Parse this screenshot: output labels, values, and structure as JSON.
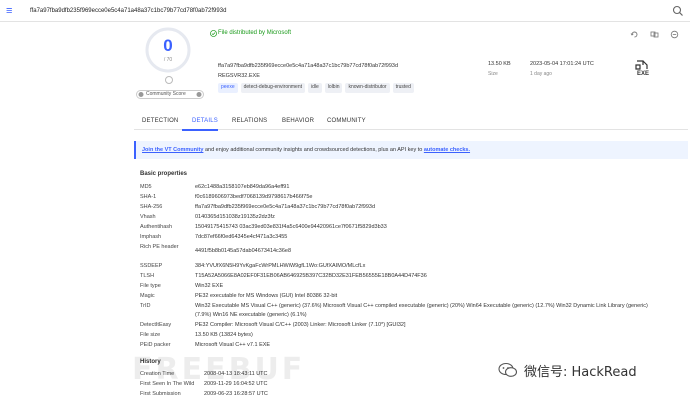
{
  "search": {
    "value": "ffa7a97fba9dfb235f969ecce0e5c4a71a48a37c1bc79b77cd78f0ab72f993d"
  },
  "score": {
    "detections": "0",
    "total": "/ 70",
    "community_label": "Community Score"
  },
  "summary": {
    "status": "File distributed by Microsoft",
    "hash": "ffa7a97fba9dfb235f969ecce0e5c4a71a48a37c1bc79b77cd78f0ab72f993d",
    "filename": "REGSVR32.EXE",
    "tags": [
      "peexe",
      "detect-debug-environment",
      "idle",
      "lolbin",
      "known-distributor",
      "trusted"
    ],
    "size_value": "13.50 KB",
    "size_label": "Size",
    "date_value": "2023-05-04 17:01:24 UTC",
    "date_label": "1 day ago",
    "filetype": "EXE"
  },
  "tabs": [
    "DETECTION",
    "DETAILS",
    "RELATIONS",
    "BEHAVIOR",
    "COMMUNITY"
  ],
  "banner": {
    "link1": "Join the VT Community",
    "text": " and enjoy additional community insights and crowdsourced detections, plus an API key to ",
    "link2": "automate checks."
  },
  "basic": {
    "title": "Basic properties",
    "rows": [
      {
        "k": "MD5",
        "v": "e62c1488a3158107eb849da96a4eff91"
      },
      {
        "k": "SHA-1",
        "v": "f0c6189606973bedf7068139d9798617b466f75e"
      },
      {
        "k": "SHA-256",
        "v": "ffa7a97fba9dfb235f969ecce0e5c4a71a48a37c1bc79b77cd78f0ab72f993d"
      },
      {
        "k": "Vhash",
        "v": "0140365d151038z19135z2dz3fz"
      },
      {
        "k": "Authentihash",
        "v": "15049175415743 03ac39ed03e831f4a5c6400e94420961ce7f0671f5829d3b33"
      },
      {
        "k": "Imphash",
        "v": "7dc87ef66f0ed64345e4cf471a3c3455"
      },
      {
        "k": "Rich PE header",
        "v": "4491f5b8b0145a57dab04673414c36e8"
      },
      {
        "k": "SSDEEP",
        "v": "384:YVUfX6N5H9YvKgaFcWrPMLHWiW9gfL1Wo:GUfXAIMO/MLcfLx"
      },
      {
        "k": "TLSH",
        "v": "T15A52A5066E8A02EF0F31EB06AB646925B397C32BD32E31FEB56555E18B0A44D474F36"
      },
      {
        "k": "File type",
        "v": "Win32 EXE"
      },
      {
        "k": "Magic",
        "v": "PE32 executable for MS Windows (GUI) Intel 80386 32-bit"
      },
      {
        "k": "TrID",
        "v": "Win32 Executable MS Visual C++ (generic) (37.6%)     Microsoft Visual C++ compiled executable (generic) (20%)     Win64 Executable (generic) (12.7%)     Win32 Dynamic Link Library (generic)"
      },
      {
        "k": "",
        "v": "(7.9%)     Win16 NE executable (generic) (6.1%)"
      },
      {
        "k": "DetectItEasy",
        "v": "PE32     Compiler: Microsoft Visual C/C++ (2003)     Linker: Microsoft Linker (7.10*) [GUI32]"
      },
      {
        "k": "File size",
        "v": "13.50 KB (13824 bytes)"
      },
      {
        "k": "PEiD packer",
        "v": "Microsoft Visual C++ v7.1 EXE"
      }
    ]
  },
  "history": {
    "title": "History",
    "rows": [
      {
        "k": "Creation Time",
        "v": "2008-04-13 18:43:11 UTC"
      },
      {
        "k": "First Seen In The Wild",
        "v": "2009-11-29 16:04:52 UTC"
      },
      {
        "k": "First Submission",
        "v": "2009-06-23 16:28:57 UTC"
      }
    ]
  },
  "watermarks": {
    "freebuf": "FREEBUF",
    "wechat": "微信号: HackRead"
  },
  "colors": {
    "accent": "#3b61ff",
    "ok": "#1a9a1a"
  }
}
